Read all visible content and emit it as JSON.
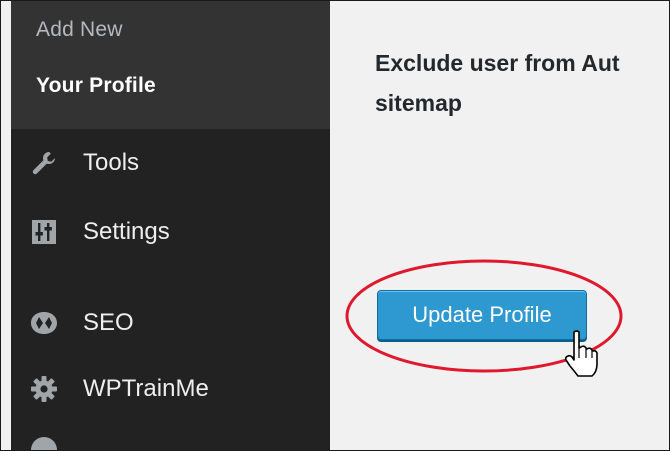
{
  "sidebar": {
    "submenu": [
      {
        "label": "Add New"
      },
      {
        "label": "Your Profile"
      }
    ],
    "items": [
      {
        "label": "Tools",
        "icon": "wrench-icon"
      },
      {
        "label": "Settings",
        "icon": "sliders-icon"
      },
      {
        "label": "SEO",
        "icon": "seo-icon"
      },
      {
        "label": "WPTrainMe",
        "icon": "gear-icon"
      }
    ]
  },
  "content": {
    "exclude_text": "Exclude user from Aut sitemap",
    "update_button": "Update Profile"
  },
  "colors": {
    "sidebar_bg": "#222222",
    "submenu_bg": "#333333",
    "button_blue": "#2e98d0",
    "highlight_red": "#e0182d"
  }
}
